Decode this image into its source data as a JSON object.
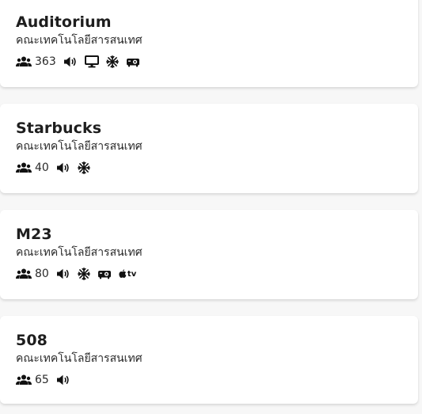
{
  "rooms": [
    {
      "name": "Auditorium",
      "faculty": "คณะเทคโนโลยีสารสนเทศ",
      "capacity": "363",
      "amenities": [
        "speaker-icon",
        "monitor-icon",
        "snowflake-icon",
        "projector-icon"
      ]
    },
    {
      "name": "Starbucks",
      "faculty": "คณะเทคโนโลยีสารสนเทศ",
      "capacity": "40",
      "amenities": [
        "speaker-icon",
        "snowflake-icon"
      ]
    },
    {
      "name": "M23",
      "faculty": "คณะเทคโนโลยีสารสนเทศ",
      "capacity": "80",
      "amenities": [
        "speaker-icon",
        "snowflake-icon",
        "projector-icon",
        "apple-tv-icon"
      ],
      "apple_tv_label": "tv"
    },
    {
      "name": "508",
      "faculty": "คณะเทคโนโลยีสารสนเทศ",
      "capacity": "65",
      "amenities": [
        "speaker-icon"
      ]
    }
  ],
  "icons": {
    "capacity": "users-icon"
  },
  "colors": {
    "card_bg": "#ffffff",
    "page_bg": "#f7f7f7",
    "text": "#1e1e1e"
  }
}
